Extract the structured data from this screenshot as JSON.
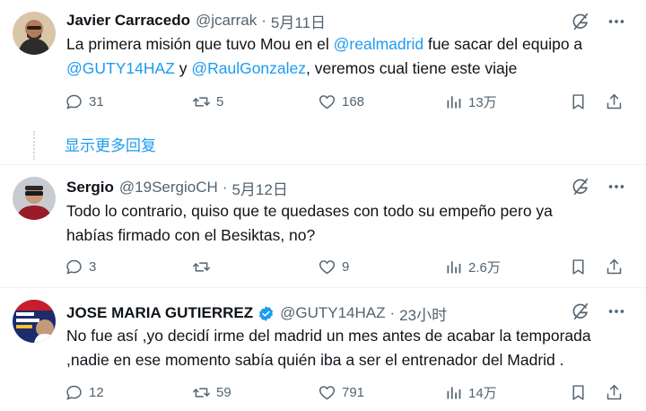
{
  "tweets": [
    {
      "name": "Javier Carracedo",
      "handle": "@jcarrak",
      "separator": "·",
      "date": "5月11日",
      "text_parts": [
        "La primera misión que tuvo Mou en el ",
        "@realmadrid",
        " fue sacar del equipo a ",
        "@GUTY14HAZ",
        " y ",
        "@RaulGonzalez",
        ", veremos cual tiene este viaje"
      ],
      "replies": "31",
      "retweets": "5",
      "likes": "168",
      "views": "13万"
    },
    {
      "name": "Sergio",
      "handle": "@19SergioCH",
      "separator": "·",
      "date": "5月12日",
      "text_line1": "Todo lo contrario, quiso que te quedases con todo su empeño pero ya",
      "text_line2": "habías firmado con el Besiktas, no?",
      "replies": "3",
      "retweets": "",
      "likes": "9",
      "views": "2.6万"
    },
    {
      "name": "JOSE MARIA GUTIERREZ",
      "handle": "@GUTY14HAZ",
      "separator": "·",
      "date": "23小时",
      "verified": true,
      "text_line1": "No fue así ,yo decidí irme del madrid un mes antes de acabar la temporada",
      "text_line2": ",nadie en ese momento sabía quién iba a ser el entrenador del Madrid .",
      "replies": "12",
      "retweets": "59",
      "likes": "791",
      "views": "14万"
    }
  ],
  "show_more": "显示更多回复",
  "colors": {
    "accent": "#1d9bf0",
    "text": "#0f1419",
    "muted": "#536471",
    "verified": "#1d9bf0"
  },
  "icons": [
    "grok-icon",
    "more-icon",
    "reply-icon",
    "retweet-icon",
    "like-icon",
    "views-icon",
    "bookmark-icon",
    "share-icon",
    "verified-badge-icon"
  ]
}
